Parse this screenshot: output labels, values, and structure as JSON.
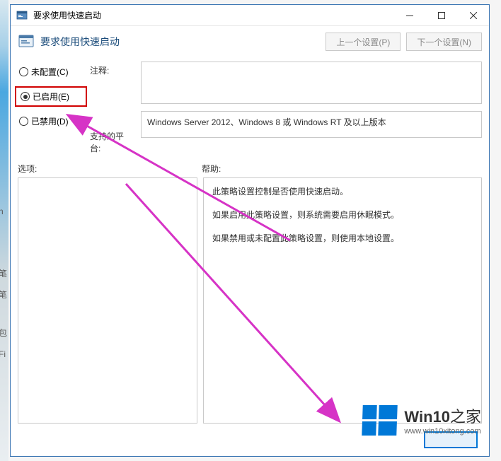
{
  "window": {
    "title": "要求使用快速启动"
  },
  "header": {
    "title": "要求使用快速启动",
    "prev_button": "上一个设置(P)",
    "next_button": "下一个设置(N)"
  },
  "radios": {
    "not_configured": "未配置(C)",
    "enabled": "已启用(E)",
    "disabled": "已禁用(D)",
    "selected": "enabled"
  },
  "labels": {
    "comment": "注释:",
    "platforms": "支持的平台:",
    "options": "选项:",
    "help": "帮助:"
  },
  "fields": {
    "comment_value": "",
    "platforms_value": "Windows Server 2012、Windows 8 或 Windows RT 及以上版本"
  },
  "help": {
    "line1": "此策略设置控制是否使用快速启动。",
    "line2": "如果启用此策略设置，则系统需要启用休眠模式。",
    "line3": "如果禁用或未配置此策略设置，则使用本地设置。"
  },
  "watermark": {
    "brand_prefix": "Win10",
    "brand_suffix": "之家",
    "url": "www.win10xitong.com"
  }
}
